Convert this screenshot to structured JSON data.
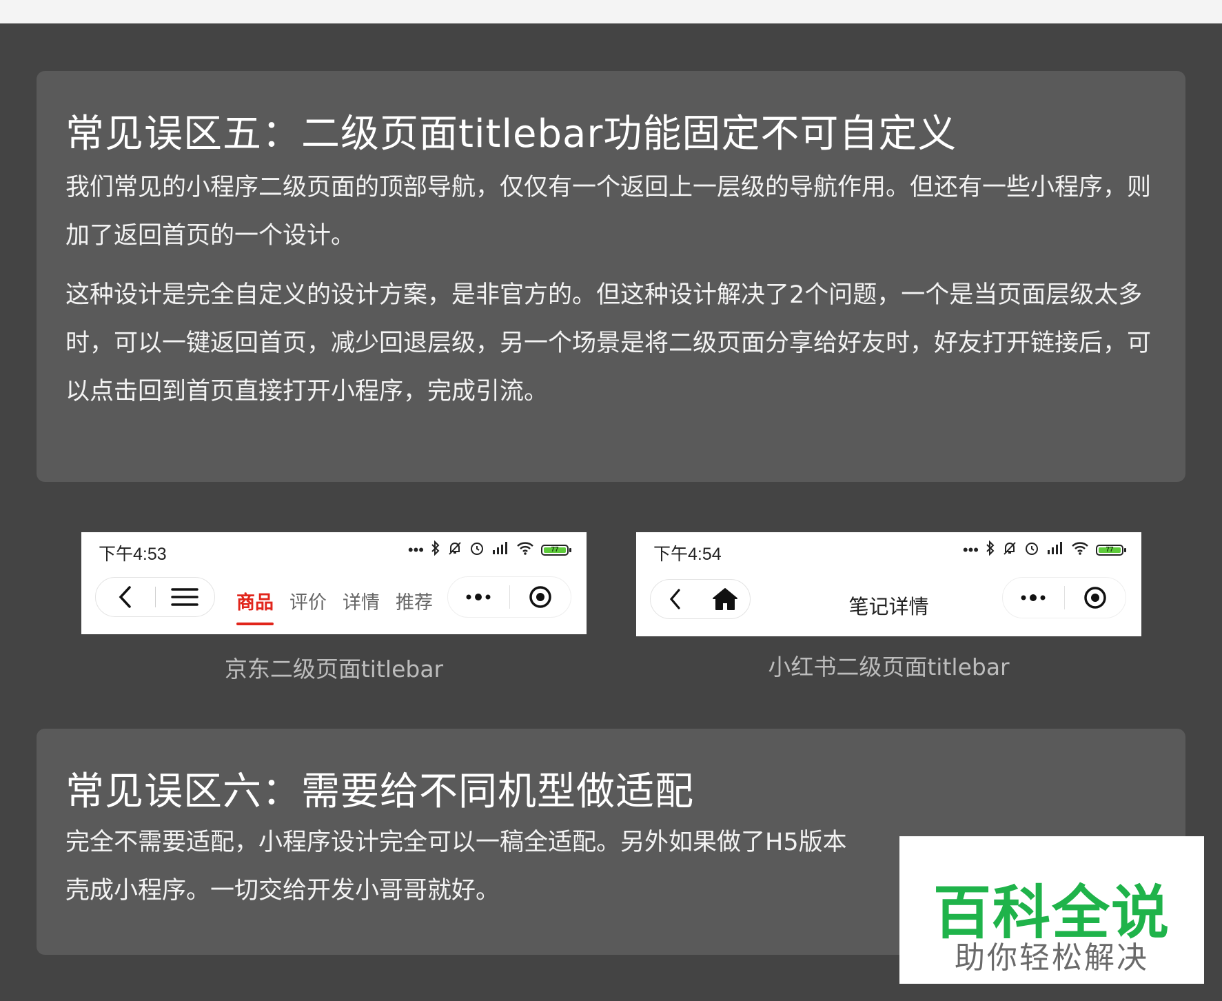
{
  "section5": {
    "title": "常见误区五：二级页面titlebar功能固定不可自定义",
    "para1": "我们常见的小程序二级页面的顶部导航，仅仅有一个返回上一层级的导航作用。但还有一些小程序，则加了返回首页的一个设计。",
    "para2": "这种设计是完全自定义的设计方案，是非官方的。但这种设计解决了2个问题，一个是当页面层级太多时，可以一键返回首页，减少回退层级，另一个场景是将二级页面分享给好友时，好友打开链接后，可以点击回到首页直接打开小程序，完成引流。"
  },
  "jd": {
    "time": "下午4:53",
    "battery": "77",
    "tabs": [
      {
        "label": "商品",
        "active": true
      },
      {
        "label": "评价",
        "active": false
      },
      {
        "label": "详情",
        "active": false
      },
      {
        "label": "推荐",
        "active": false
      }
    ],
    "caption": "京东二级页面titlebar"
  },
  "xhs": {
    "time": "下午4:54",
    "battery": "77",
    "title": "笔记详情",
    "caption": "小红书二级页面titlebar"
  },
  "section6": {
    "title": "常见误区六：需要给不同机型做适配",
    "para1": "完全不需要适配，小程序设计完全可以一稿全适配。另外如果做了H5版本",
    "para2": "壳成小程序。一切交给开发小哥哥就好。"
  },
  "watermark": {
    "main": "百科全说",
    "sub": "助你轻松解决"
  },
  "colors": {
    "background": "#444444",
    "card": "#5a5a5a",
    "jd_accent": "#e1251b",
    "watermark_green": "#1fb34a",
    "battery_green": "#5ecb3b"
  }
}
